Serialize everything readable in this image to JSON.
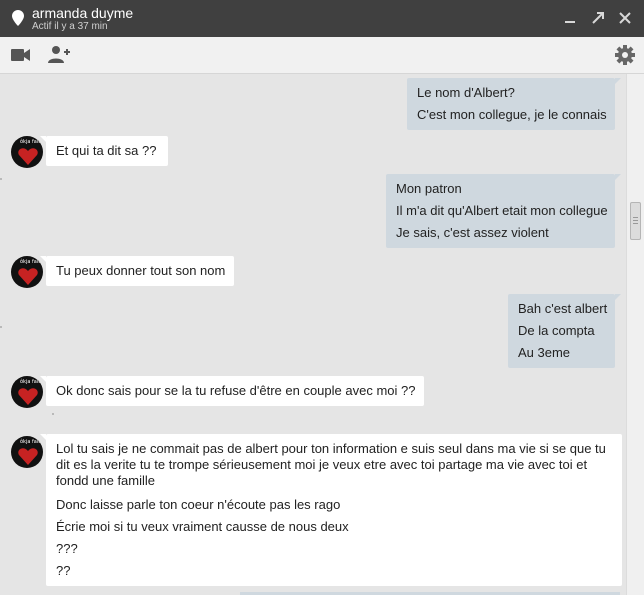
{
  "window": {
    "contact_name": "armanda duyme",
    "status": "Actif il y a 37 min"
  },
  "icons": {
    "location": "location-pin-icon",
    "minimize": "minimize-icon",
    "popout": "popout-icon",
    "close": "close-icon",
    "video": "video-camera-icon",
    "add_person": "add-person-icon",
    "settings": "gear-icon",
    "avatar": "contact-avatar"
  },
  "colors": {
    "titlebar": "#404040",
    "outgoing_bubble": "#cfd8df",
    "incoming_bubble": "#ffffff",
    "chat_background": "#e5e5e5"
  },
  "messages": [
    {
      "direction": "out",
      "lines": [
        "Le nom d'Albert?",
        "C'est mon collegue, je le connais"
      ]
    },
    {
      "direction": "in",
      "lines": [
        "Et qui ta dit sa ??"
      ]
    },
    {
      "direction": "out",
      "lines": [
        "Mon patron",
        "Il m'a dit qu'Albert etait mon collegue",
        "Je sais, c'est assez violent"
      ]
    },
    {
      "direction": "in",
      "lines": [
        "Tu peux donner tout son nom"
      ]
    },
    {
      "direction": "out",
      "lines": [
        "Bah c'est albert",
        "De la compta",
        "Au 3eme"
      ]
    },
    {
      "direction": "in",
      "lines": [
        "Ok donc sais pour se la tu refuse d'être en couple avec moi ??"
      ]
    },
    {
      "direction": "in",
      "lines": [
        "Lol tu sais je ne commait pas de albert pour ton information e suis seul dans ma vie si se que tu dit es la verite tu te trompe sérieusement moi je veux etre avec toi partage ma vie avec toi et fondd une famille",
        "Donc laisse parle ton coeur n'écoute pas les rago",
        "Écrie moi si tu veux vraiment causse de nous deux",
        "???",
        "??"
      ]
    }
  ]
}
